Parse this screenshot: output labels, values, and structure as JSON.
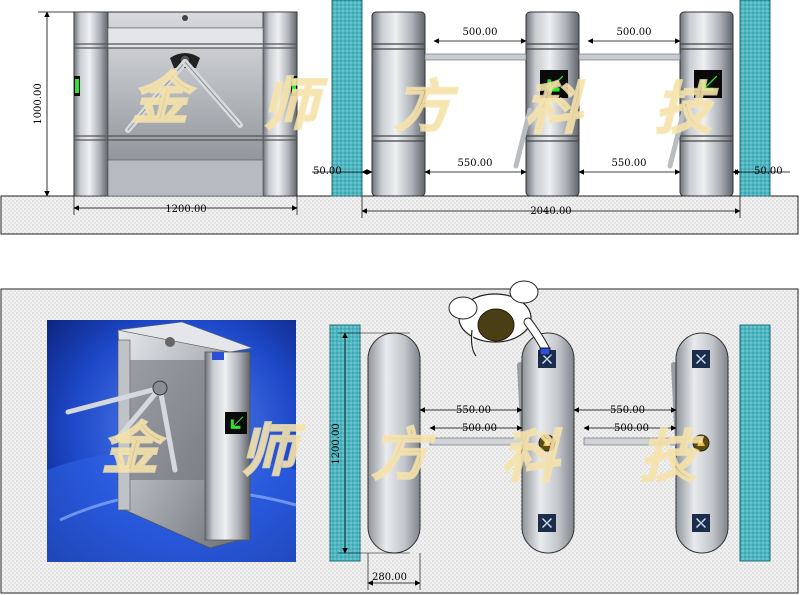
{
  "front_view": {
    "height_label": "1000.00",
    "width_label": "1200.00"
  },
  "side_view": {
    "arm_gap_left_label": "500.00",
    "arm_gap_right_label": "500.00",
    "lane_width_left_label": "550.00",
    "lane_width_right_label": "550.00",
    "left_wall_gap_label": "50.00",
    "right_wall_gap_label": "50.00",
    "total_width_label": "2040.00"
  },
  "plan_view": {
    "body_length_label": "1200.00",
    "body_width_label": "280.00",
    "lane_width_left_label": "550.00",
    "lane_width_right_label": "550.00",
    "arm_gap_left_label": "500.00",
    "arm_gap_right_label": "500.00"
  },
  "watermark": [
    "金",
    "师",
    "方",
    "科",
    "技"
  ],
  "colors": {
    "steel": "#a7abb2",
    "panel_teal": "#4fb7c2",
    "ground": "#ececec",
    "arrow_green": "#2ee32e",
    "photo_blue": "#1d48c8"
  },
  "icons": [
    "green-arrow-indicator-icon",
    "card-reader-icon",
    "person-icon"
  ]
}
